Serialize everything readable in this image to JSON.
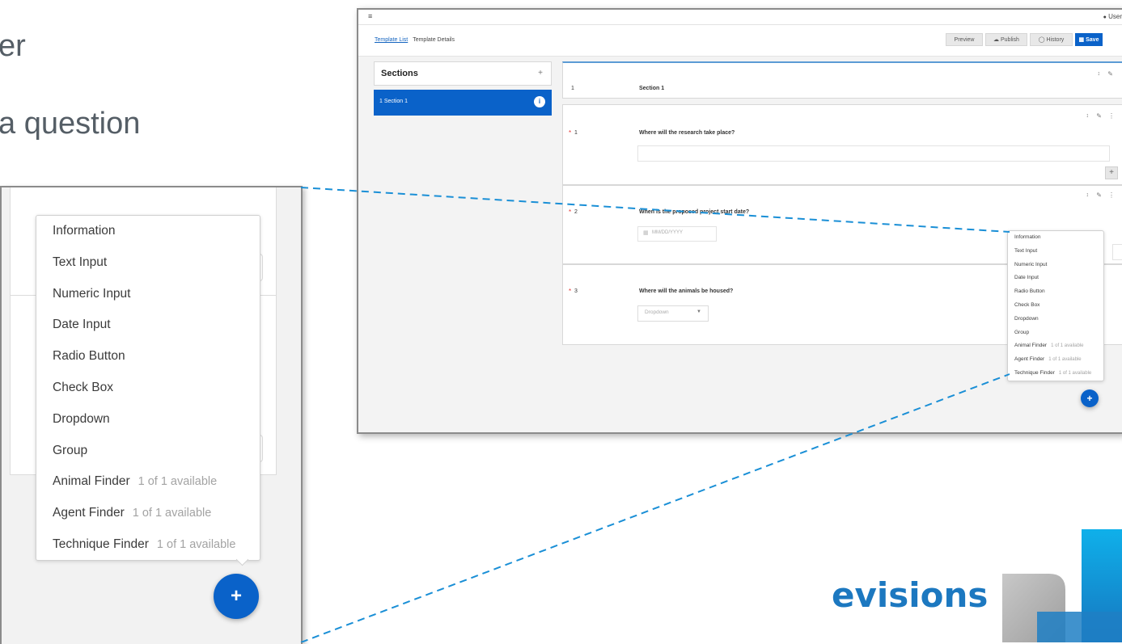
{
  "slide": {
    "line1": "er",
    "line2": "a question"
  },
  "app": {
    "topbar": {
      "menu_icon": "≡",
      "user_label": "User"
    },
    "breadcrumb": {
      "link": "Template List",
      "current": "Template Details"
    },
    "toolbar": {
      "preview": "Preview",
      "publish": "Publish",
      "history": "History",
      "save": "Save"
    },
    "sections_panel": {
      "title": "Sections",
      "add": "+",
      "items": [
        {
          "label": "1 Section 1",
          "badge": "i"
        }
      ]
    },
    "section_header": {
      "number": "1",
      "title": "Section 1"
    },
    "questions": [
      {
        "required": "*",
        "number": "1",
        "text": "Where will the research take place?"
      },
      {
        "required": "*",
        "number": "2",
        "text": "When is the proposed project start date?",
        "placeholder": "MM/DD/YYYY"
      },
      {
        "required": "*",
        "number": "3",
        "text": "Where will the animals be housed?",
        "select_value": "Dropdown"
      }
    ],
    "add_row_button": "+",
    "fab_label": "+"
  },
  "add_menu": {
    "items": [
      {
        "label": "Information",
        "availability": ""
      },
      {
        "label": "Text Input",
        "availability": ""
      },
      {
        "label": "Numeric Input",
        "availability": ""
      },
      {
        "label": "Date Input",
        "availability": ""
      },
      {
        "label": "Radio Button",
        "availability": ""
      },
      {
        "label": "Check Box",
        "availability": ""
      },
      {
        "label": "Dropdown",
        "availability": ""
      },
      {
        "label": "Group",
        "availability": ""
      },
      {
        "label": "Animal Finder",
        "availability": "1 of 1 available"
      },
      {
        "label": "Agent Finder",
        "availability": "1 of 1 available"
      },
      {
        "label": "Technique Finder",
        "availability": "1 of 1 available"
      }
    ],
    "fab_label": "+"
  },
  "brand": {
    "logo_text": "evisions"
  },
  "colors": {
    "accent_blue": "#0a62c9",
    "callout_line": "#1a8fd6",
    "slide_text": "#555e66",
    "logo_blue": "#1c78c0",
    "logo_grey": "#b8b8b8",
    "logo_cyan": "#0aa3e0"
  }
}
